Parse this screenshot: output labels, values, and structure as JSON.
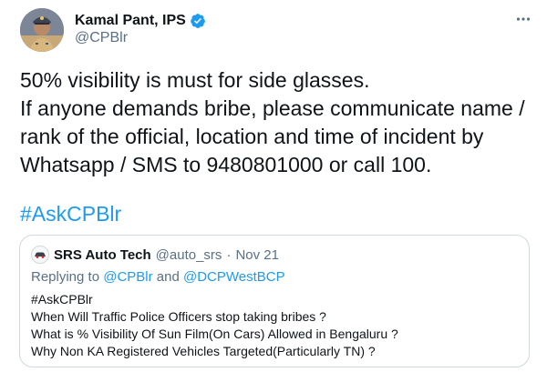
{
  "author": {
    "name": "Kamal Pant, IPS",
    "handle": "@CPBlr",
    "verified": true
  },
  "tweet": {
    "lines": [
      "50% visibility is must for side glasses.",
      "If anyone demands bribe, please communicate name /",
      "rank of the official, location and time of incident by",
      "Whatsapp / SMS to 9480801000 or call 100."
    ],
    "hashtag": "#AskCPBlr"
  },
  "quoted": {
    "name": "SRS Auto Tech",
    "handle": "@auto_srs",
    "separator": "·",
    "date": "Nov 21",
    "replying_prefix": "Replying to",
    "replying_user1": "@CPBlr",
    "replying_and": "and",
    "replying_user2": "@DCPWestBCP",
    "lines": [
      "#AskCPBlr",
      "When Will Traffic Police Officers stop taking bribes ?",
      "What is % Visibility Of Sun Film(On Cars) Allowed in Bengaluru ?",
      "Why Non KA Registered Vehicles Targeted(Particularly TN) ?"
    ]
  },
  "icons": {
    "more": "more-horizontal-icon",
    "verified": "verified-badge-icon"
  },
  "colors": {
    "link": "#1d9bf0",
    "secondary_text": "#5b7083",
    "border": "#cfd9de"
  }
}
